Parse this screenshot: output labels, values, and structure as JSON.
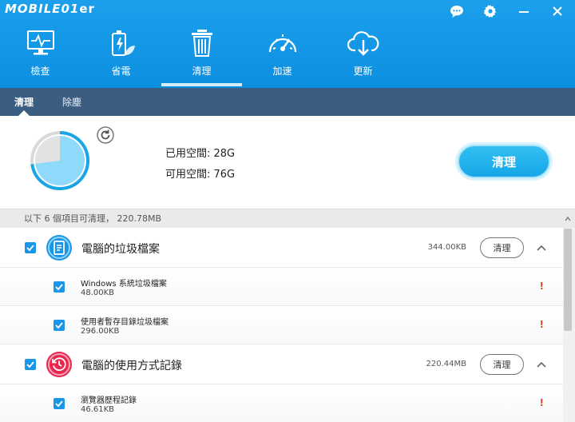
{
  "app": {
    "title_wordmark": "MOBILE01",
    "title_suffix": "er"
  },
  "window_buttons": [
    {
      "name": "feedback-icon"
    },
    {
      "name": "settings-icon"
    },
    {
      "name": "minimize-icon"
    },
    {
      "name": "close-icon"
    }
  ],
  "nav": {
    "items": [
      {
        "label": "檢查",
        "icon": "monitor-icon"
      },
      {
        "label": "省電",
        "icon": "battery-leaf-icon"
      },
      {
        "label": "清理",
        "icon": "trash-icon",
        "active": true
      },
      {
        "label": "加速",
        "icon": "speedometer-icon"
      },
      {
        "label": "更新",
        "icon": "cloud-download-icon"
      }
    ]
  },
  "tabs": [
    {
      "label": "清理",
      "active": true
    },
    {
      "label": "除塵",
      "active": false
    }
  ],
  "storage": {
    "used_label": "已用空間: 28G",
    "free_label": "可用空間: 76G",
    "used_fraction": 0.27,
    "clean_button": "清理"
  },
  "list": {
    "header": "以下 6 個項目可清理， 220.78MB",
    "categories": [
      {
        "name": "電腦的垃圾檔案",
        "size": "344.00KB",
        "clean_label": "清理",
        "icon": "document-icon",
        "color": "#1a96e8",
        "items": [
          {
            "name": "Windows 系統垃圾檔案",
            "size": "48.00KB"
          },
          {
            "name": "使用者暫存目錄垃圾檔案",
            "size": "296.00KB"
          }
        ]
      },
      {
        "name": "電腦的使用方式記錄",
        "size": "220.44MB",
        "clean_label": "清理",
        "icon": "history-icon",
        "color": "#e8264f",
        "items": [
          {
            "name": "瀏覽器歷程記錄",
            "size": "46.61KB"
          }
        ]
      }
    ],
    "warn_mark": "!"
  },
  "colors": {
    "header_blue": "#1a9fea",
    "tab_bar": "#3c5d82",
    "accent": "#1a96e8",
    "warn": "#e2452b"
  }
}
